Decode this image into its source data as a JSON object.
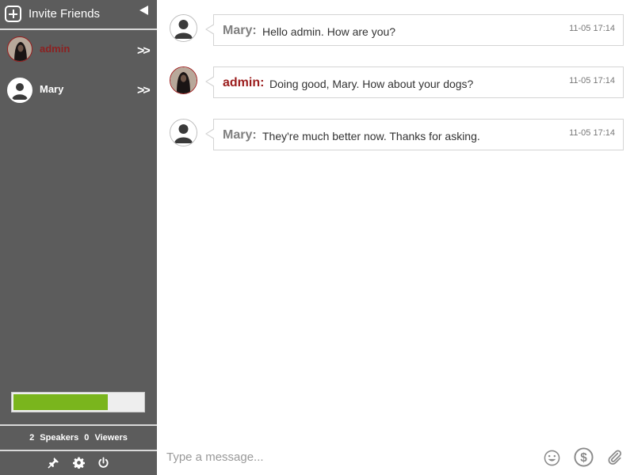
{
  "sidebar": {
    "invite_label": "Invite Friends",
    "users": [
      {
        "name": "admin",
        "name_color": "#8c2121"
      },
      {
        "name": "Mary",
        "name_color": "#ffffff"
      }
    ],
    "progress_fraction": 0.73,
    "progress_color": "#7ab51d",
    "speakers_count": "2",
    "speakers_label": "Speakers",
    "viewers_count": "0",
    "viewers_label": "Viewers",
    "tools": [
      "pin-icon",
      "gear-icon",
      "power-icon"
    ]
  },
  "messages": [
    {
      "author": "Mary:",
      "author_color": "#808080",
      "text": "Hello admin. How are you?",
      "time": "11-05 17:14"
    },
    {
      "author": "admin:",
      "author_color": "#9b1c1c",
      "text": "Doing good, Mary. How about your dogs?",
      "time": "11-05 17:14"
    },
    {
      "author": "Mary:",
      "author_color": "#808080",
      "text": "They're much better now. Thanks for asking.",
      "time": "11-05 17:14"
    }
  ],
  "composer": {
    "placeholder": "Type a message...",
    "icons": [
      "smiley-icon",
      "dollar-icon",
      "paperclip-icon"
    ]
  }
}
